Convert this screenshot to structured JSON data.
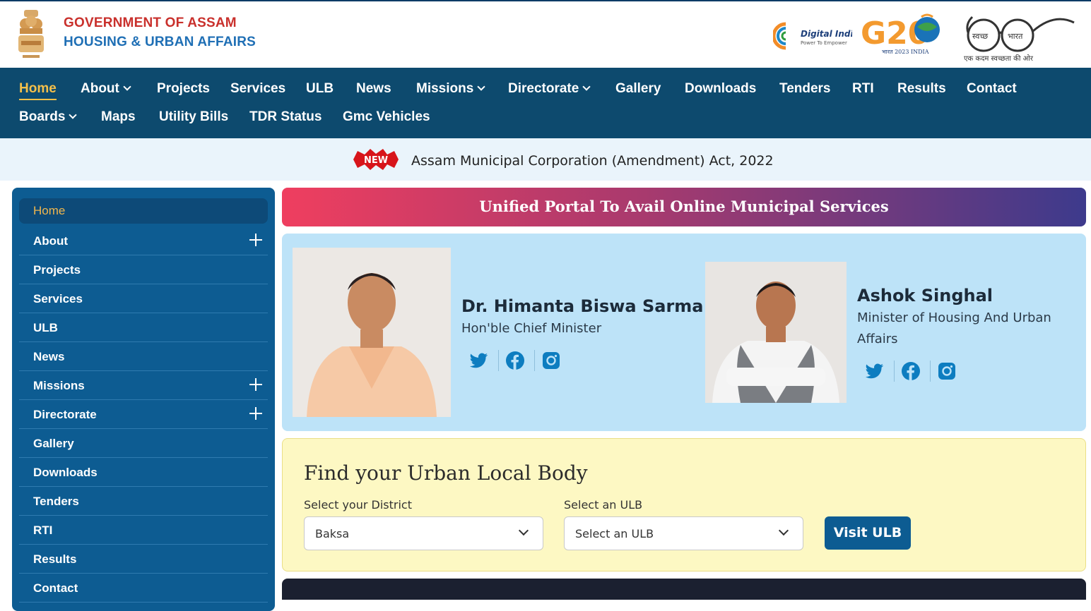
{
  "header": {
    "line1": "GOVERNMENT OF ASSAM",
    "line2": "HOUSING & URBAN AFFAIRS",
    "digital_india": {
      "title": "Digital India",
      "tagline": "Power To Empower"
    },
    "g20": {
      "title": "G20",
      "sub": "भारत 2023 INDIA"
    },
    "swachh": {
      "left": "स्वच्छ",
      "right": "भारत",
      "tagline": "एक कदम स्वच्छता की ओर"
    }
  },
  "topnav": {
    "items": [
      {
        "label": "Home",
        "active": true
      },
      {
        "label": "About",
        "dropdown": true
      },
      {
        "label": "Projects"
      },
      {
        "label": "Services"
      },
      {
        "label": "ULB"
      },
      {
        "label": "News"
      },
      {
        "label": "Missions",
        "dropdown": true
      },
      {
        "label": "Directorate",
        "dropdown": true
      },
      {
        "label": "Gallery"
      },
      {
        "label": "Downloads"
      },
      {
        "label": "Tenders"
      },
      {
        "label": "RTI"
      },
      {
        "label": "Results"
      },
      {
        "label": "Contact"
      },
      {
        "label": "Boards",
        "dropdown": true
      },
      {
        "label": "Maps"
      },
      {
        "label": "Utility Bills"
      },
      {
        "label": "TDR Status"
      },
      {
        "label": "Gmc Vehicles"
      }
    ]
  },
  "ticker": {
    "badge": "NEW",
    "text": "Assam Municipal Corporation (Amendment) Act, 2022"
  },
  "sidebar": {
    "items": [
      {
        "label": "Home",
        "active": true
      },
      {
        "label": "About",
        "expand": true
      },
      {
        "label": "Projects"
      },
      {
        "label": "Services"
      },
      {
        "label": "ULB"
      },
      {
        "label": "News"
      },
      {
        "label": "Missions",
        "expand": true
      },
      {
        "label": "Directorate",
        "expand": true
      },
      {
        "label": "Gallery"
      },
      {
        "label": "Downloads"
      },
      {
        "label": "Tenders"
      },
      {
        "label": "RTI"
      },
      {
        "label": "Results"
      },
      {
        "label": "Contact"
      }
    ]
  },
  "banner": {
    "text": "Unified Portal To Avail Online Municipal Services"
  },
  "ministers": [
    {
      "name": "Dr. Himanta Biswa Sarma",
      "title": "Hon'ble Chief Minister"
    },
    {
      "name": "Ashok Singhal",
      "title": "Minister of Housing And Urban Affairs"
    }
  ],
  "find_ulb": {
    "title": "Find your Urban Local Body",
    "district_label": "Select your District",
    "district_value": "Baksa",
    "ulb_label": "Select an ULB",
    "ulb_value": "Select an ULB",
    "button": "Visit ULB"
  },
  "colors": {
    "nav_bg": "#0d4a6e",
    "sidebar_bg": "#0d5c92",
    "accent": "#f5c04a",
    "brand_red": "#c9302c",
    "brand_blue": "#1f6fb5"
  }
}
